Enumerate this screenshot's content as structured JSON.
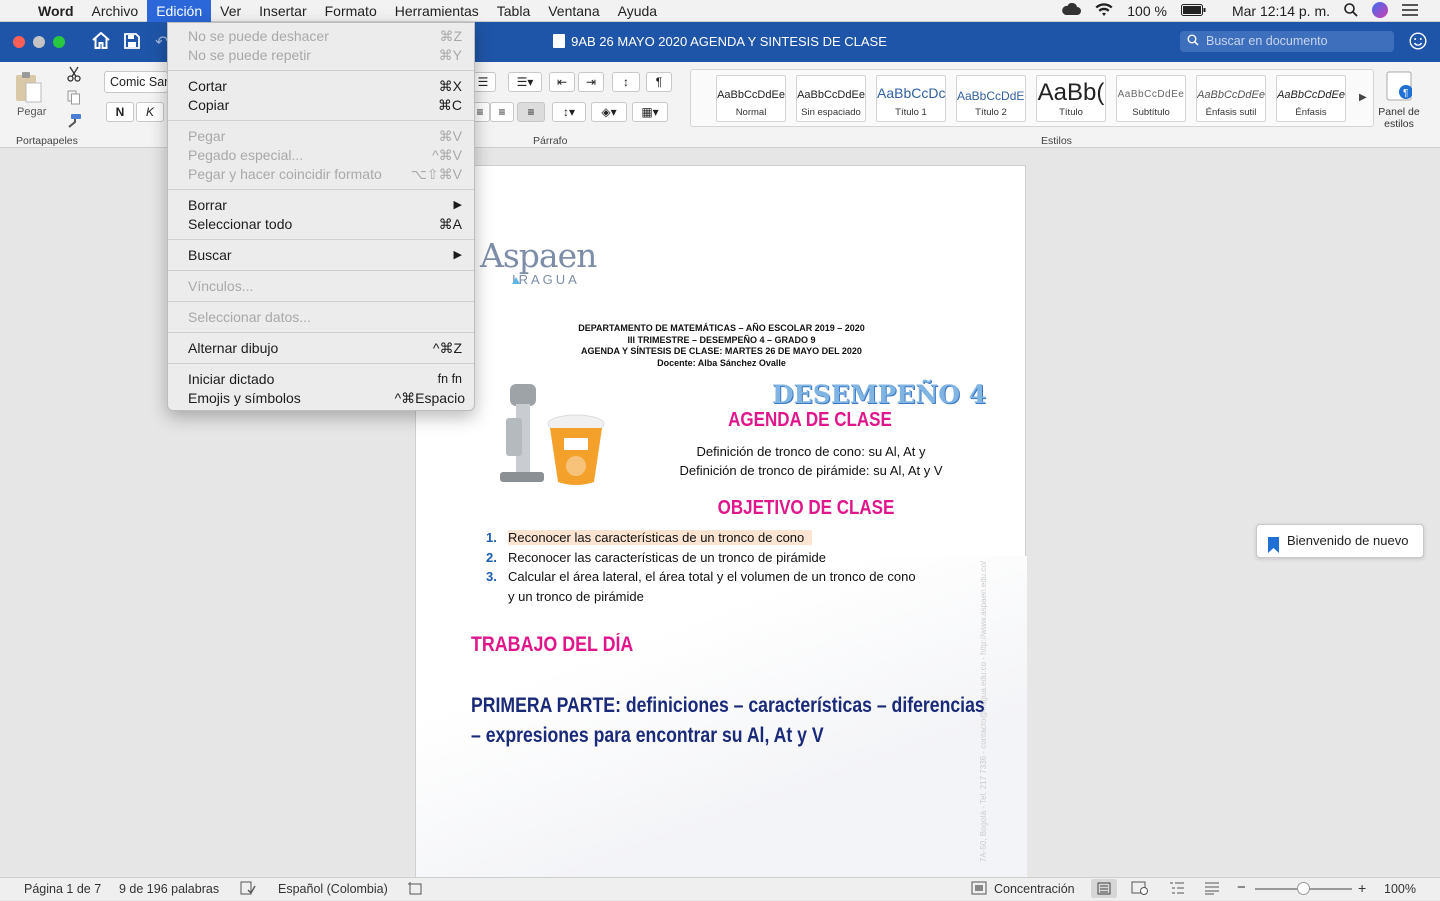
{
  "menubar": {
    "app": "Word",
    "items": [
      "Archivo",
      "Edición",
      "Ver",
      "Insertar",
      "Formato",
      "Herramientas",
      "Tabla",
      "Ventana",
      "Ayuda"
    ],
    "battery": "100 %",
    "clock": "Mar 12:14 p. m."
  },
  "window": {
    "title": "9AB 26 MAYO 2020 AGENDA Y SINTESIS DE CLASE",
    "search_placeholder": "Buscar en documento"
  },
  "ribbon": {
    "paste_label": "Pegar",
    "clipboard_group": "Portapapeles",
    "font_name": "Comic Sar",
    "bold": "N",
    "italic": "K",
    "paragraph_group": "Párrafo",
    "styles_group": "Estilos",
    "styles_panel": "Panel de estilos",
    "styles": [
      {
        "sample": "AaBbCcDdEe",
        "name": "Normal"
      },
      {
        "sample": "AaBbCcDdEe",
        "name": "Sin espaciado"
      },
      {
        "sample": "AaBbCcDc",
        "name": "Título 1"
      },
      {
        "sample": "AaBbCcDdEe",
        "name": "Título 2"
      },
      {
        "sample": "AaBb(",
        "name": "Título"
      },
      {
        "sample": "AaBbCcDdEe",
        "name": "Subtítulo"
      },
      {
        "sample": "AaBbCcDdEe",
        "name": "Énfasis sutil"
      },
      {
        "sample": "AaBbCcDdEe",
        "name": "Énfasis"
      }
    ]
  },
  "edit_menu": {
    "undo": {
      "label": "No se puede deshacer",
      "shortcut": "⌘Z"
    },
    "redo": {
      "label": "No se puede repetir",
      "shortcut": "⌘Y"
    },
    "cut": {
      "label": "Cortar",
      "shortcut": "⌘X"
    },
    "copy": {
      "label": "Copiar",
      "shortcut": "⌘C"
    },
    "paste": {
      "label": "Pegar",
      "shortcut": "⌘V"
    },
    "paste_special": {
      "label": "Pegado especial...",
      "shortcut": "^⌘V"
    },
    "paste_match": {
      "label": "Pegar y hacer coincidir formato",
      "shortcut": "⌥⇧⌘V"
    },
    "clear": {
      "label": "Borrar",
      "shortcut": "▶"
    },
    "select_all": {
      "label": "Seleccionar todo",
      "shortcut": "⌘A"
    },
    "find": {
      "label": "Buscar",
      "shortcut": "▶"
    },
    "links": {
      "label": "Vínculos...",
      "shortcut": ""
    },
    "select_data": {
      "label": "Seleccionar datos...",
      "shortcut": ""
    },
    "toggle_drawing": {
      "label": "Alternar dibujo",
      "shortcut": "^⌘Z"
    },
    "dictation": {
      "label": "Iniciar dictado",
      "shortcut": "fn fn"
    },
    "emoji": {
      "label": "Emojis y símbolos",
      "shortcut": "^⌘Espacio"
    }
  },
  "document": {
    "logo_main": "Aspaen",
    "logo_sub": "IRAGUA",
    "header_lines": [
      "DEPARTAMENTO DE MATEMÁTICAS – AÑO ESCOLAR 2019 – 2020",
      "III TRIMESTRE – DESEMPEÑO 4 – GRADO 9",
      "AGENDA Y SÍNTESIS DE CLASE: MARTES 26 DE MAYO DEL 2020",
      "Docente: Alba Sánchez Ovalle"
    ],
    "desempeno": "DESEMPEÑO 4",
    "agenda_title": "AGENDA DE CLASE",
    "agenda_lines": [
      "Definición de tronco de cono: su Al, At y",
      "Definición de tronco de pirámide: su Al, At y V"
    ],
    "objective_title": "OBJETIVO DE CLASE",
    "objectives": [
      {
        "num": "1.",
        "text": "Reconocer las características de un tronco de cono"
      },
      {
        "num": "2.",
        "text": "Reconocer las características de un tronco de pirámide"
      },
      {
        "num": "3.",
        "text": "Calcular el área lateral, el área total y el volumen de un tronco de cono"
      },
      {
        "num": "",
        "text": "y un tronco de pirámide"
      }
    ],
    "trabajo_title": "TRABAJO DEL DÍA",
    "primera_parte_1": "PRIMERA PARTE: definiciones – características – diferencias",
    "primera_parte_2": "– expresiones para encontrar su Al, At y V",
    "watermark": "7A-50, Bogotá - Tel. 217 7336 - contacto@iragua.edu.co - http://www.aspaen.edu.co/"
  },
  "welcome_tag": "Bienvenido de nuevo",
  "status": {
    "page": "Página 1 de 7",
    "words": "9 de 196 palabras",
    "language": "Español (Colombia)",
    "focus": "Concentración",
    "zoom": "100%"
  },
  "colors": {
    "titlebar": "#1f55a8",
    "menu_highlight": "#2b67d8",
    "magenta_heading": "#e0168c",
    "navy_heading": "#1a2a78"
  }
}
